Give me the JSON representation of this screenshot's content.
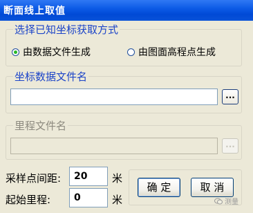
{
  "window": {
    "title": "断面线上取值"
  },
  "coord_method": {
    "legend": "选择已知坐标获取方式",
    "options": [
      {
        "label": "由数据文件生成",
        "selected": true
      },
      {
        "label": "由图面高程点生成",
        "selected": false
      }
    ]
  },
  "coord_file": {
    "legend": "坐标数据文件名",
    "value": "",
    "browse_label": "..."
  },
  "mileage_file": {
    "legend": "里程文件名",
    "value": "",
    "browse_label": "..."
  },
  "sampling": {
    "interval_label": "采样点间距:",
    "interval_value": "20",
    "interval_unit": "米",
    "start_label": "起始里程:",
    "start_value": "0",
    "start_unit": "米"
  },
  "buttons": {
    "ok": "确 定",
    "cancel": "取 消"
  },
  "watermark": {
    "text": "测量",
    "icon": "wechat-icon"
  }
}
